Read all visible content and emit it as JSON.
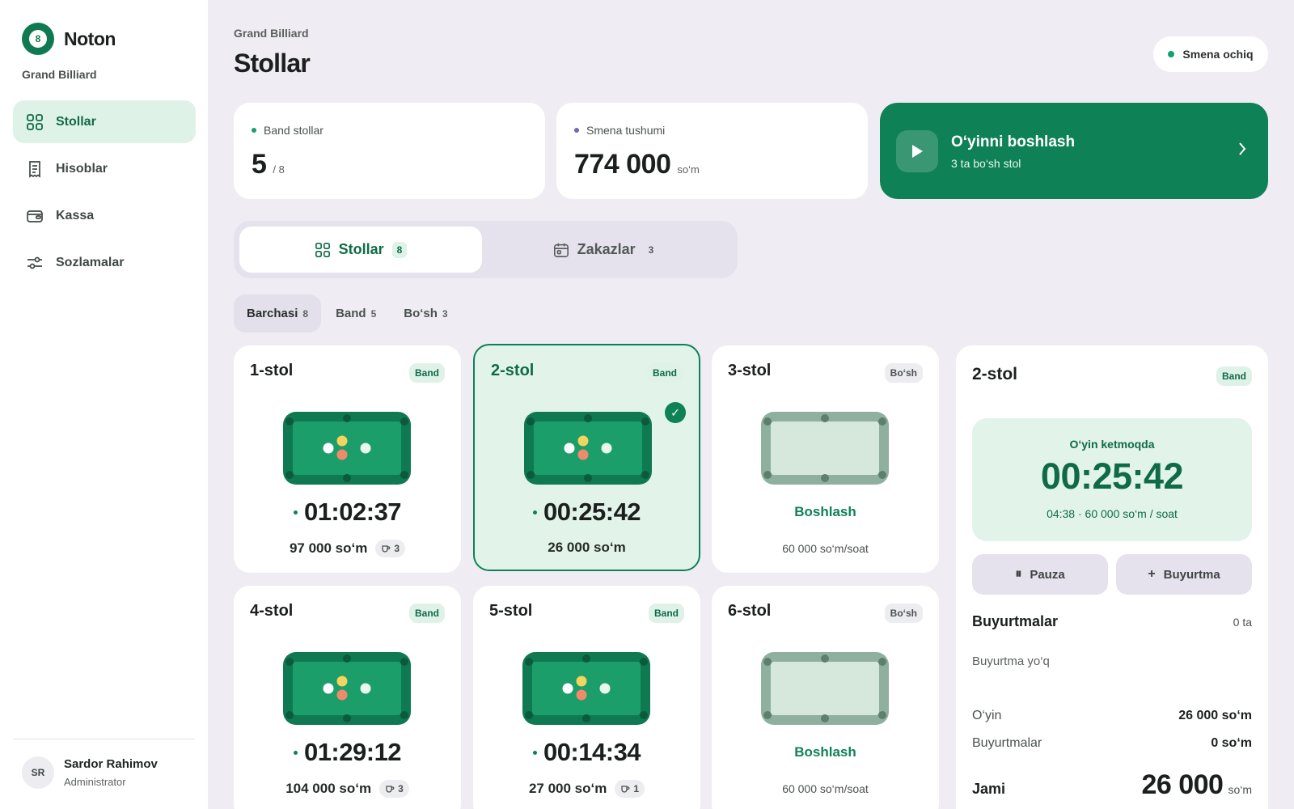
{
  "brand": {
    "name": "Noton",
    "logo_char": "8",
    "venue": "Grand Billiard"
  },
  "sidebar": {
    "items": [
      {
        "label": "Stollar",
        "icon": "grid-icon",
        "active": true
      },
      {
        "label": "Hisoblar",
        "icon": "receipt-icon",
        "active": false
      },
      {
        "label": "Kassa",
        "icon": "wallet-icon",
        "active": false
      },
      {
        "label": "Sozlamalar",
        "icon": "sliders-icon",
        "active": false
      }
    ]
  },
  "user": {
    "initials": "SR",
    "name": "Sardor Rahimov",
    "role": "Administrator"
  },
  "header": {
    "breadcrumb": "Grand Billiard",
    "title": "Stollar",
    "shift_status": "Smena ochiq"
  },
  "stats": {
    "busy": {
      "label": "Band stollar",
      "value": "5",
      "total": "/ 8"
    },
    "revenue": {
      "label": "Smena tushumi",
      "value": "774 000",
      "unit": "so‘m"
    }
  },
  "cta": {
    "title": "O‘yinni boshlash",
    "subtitle": "3 ta bo‘sh stol"
  },
  "tabs": [
    {
      "label": "Stollar",
      "count": "8",
      "active": true
    },
    {
      "label": "Zakazlar",
      "count": "3",
      "active": false
    }
  ],
  "filters": [
    {
      "label": "Barchasi",
      "count": "8",
      "active": true
    },
    {
      "label": "Band",
      "count": "5",
      "active": false
    },
    {
      "label": "Bo‘sh",
      "count": "3",
      "active": false
    }
  ],
  "tables": [
    {
      "name": "1-stol",
      "status": "Band",
      "timer": "01:02:37",
      "amount": "97 000 so‘m",
      "orders": "3"
    },
    {
      "name": "2-stol",
      "status": "Band",
      "timer": "00:25:42",
      "amount": "26 000 so‘m",
      "selected": true
    },
    {
      "name": "3-stol",
      "status": "Bo‘sh",
      "action": "Boshlash",
      "rate": "60 000 so‘m/soat"
    },
    {
      "name": "4-stol",
      "status": "Band",
      "timer": "01:29:12",
      "amount": "104 000 so‘m",
      "orders": "3"
    },
    {
      "name": "5-stol",
      "status": "Band",
      "timer": "00:14:34",
      "amount": "27 000 so‘m",
      "orders": "1"
    },
    {
      "name": "6-stol",
      "status": "Bo‘sh",
      "action": "Boshlash",
      "rate": "60 000 so‘m/soat"
    }
  ],
  "detail": {
    "title": "2-stol",
    "status": "Band",
    "game_status": "O‘yin ketmoqda",
    "timer": "00:25:42",
    "rate_info": "04:38 · 60 000 so‘m / soat",
    "pause_label": "Pauza",
    "order_label": "Buyurtma",
    "orders_title": "Buyurtmalar",
    "orders_count": "0 ta",
    "orders_empty": "Buyurtma yo‘q",
    "game_label": "O‘yin",
    "game_amount": "26 000 so‘m",
    "orders_label": "Buyurtmalar",
    "orders_amount": "0 so‘m",
    "total_label": "Jami",
    "total_value": "26 000",
    "total_unit": "so‘m"
  },
  "colors": {
    "accent": "#0f8156",
    "accent_light": "#dff2e7",
    "background": "#efedf3",
    "felt_dark": "#0f7a52",
    "felt": "#1b9e6a",
    "felt_idle": "#8fb09f"
  }
}
